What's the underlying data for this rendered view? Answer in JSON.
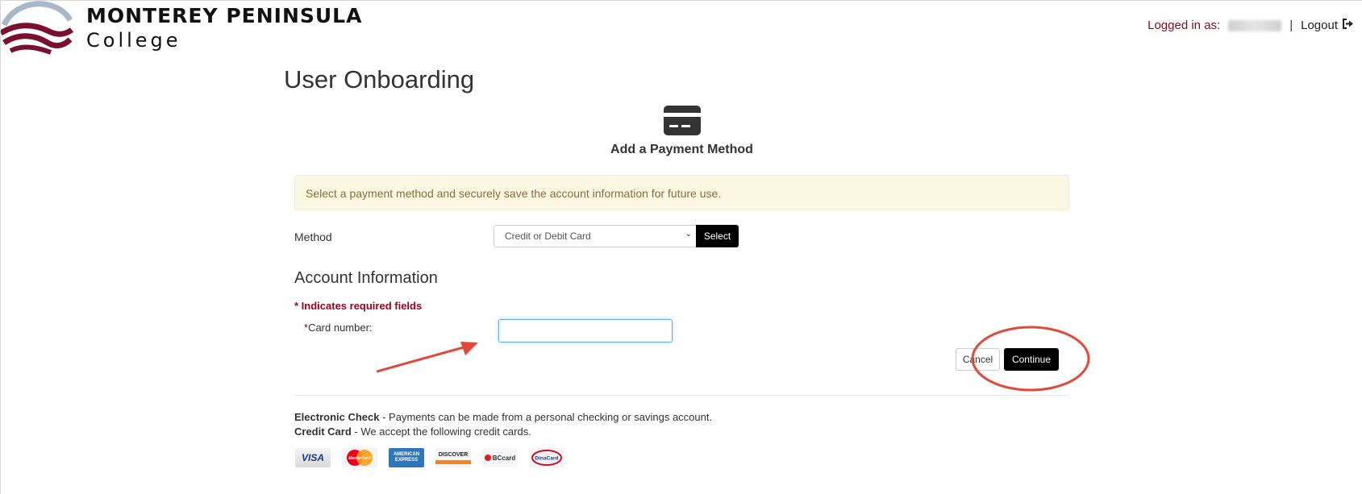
{
  "header": {
    "brand_line1": "MONTEREY PENINSULA",
    "brand_line2": "College",
    "logged_in_label": "Logged in as:",
    "user_name": "",
    "separator": "|",
    "logout_label": "Logout"
  },
  "page": {
    "title": "User Onboarding",
    "subtitle": "Add a Payment Method",
    "info_message": "Select a payment method and securely save the account information for future use."
  },
  "method": {
    "label": "Method",
    "selected": "Credit or Debit Card",
    "select_button": "Select"
  },
  "account": {
    "title": "Account Information",
    "required_note": "* Indicates required fields",
    "card_number_star": "*",
    "card_number_label": "Card number:",
    "card_number_value": ""
  },
  "actions": {
    "cancel": "Cancel",
    "continue": "Continue"
  },
  "payment_info": {
    "echeck_title": "Electronic Check",
    "echeck_text": " - Payments can be made from a personal checking or savings account.",
    "credit_title": "Credit Card",
    "credit_text": " - We accept the following credit cards."
  },
  "card_logos": {
    "visa": "VISA",
    "mastercard": "MasterCard",
    "amex": "AMERICAN EXPRESS",
    "discover": "DISCOVER",
    "bccard": "BCcard",
    "diners": "DinaCard"
  },
  "colors": {
    "brand_maroon": "#7a1020",
    "required_red": "#a00020",
    "annotation_red": "#e04a3a",
    "button_black": "#000000",
    "info_bg": "#fcf8e3"
  }
}
